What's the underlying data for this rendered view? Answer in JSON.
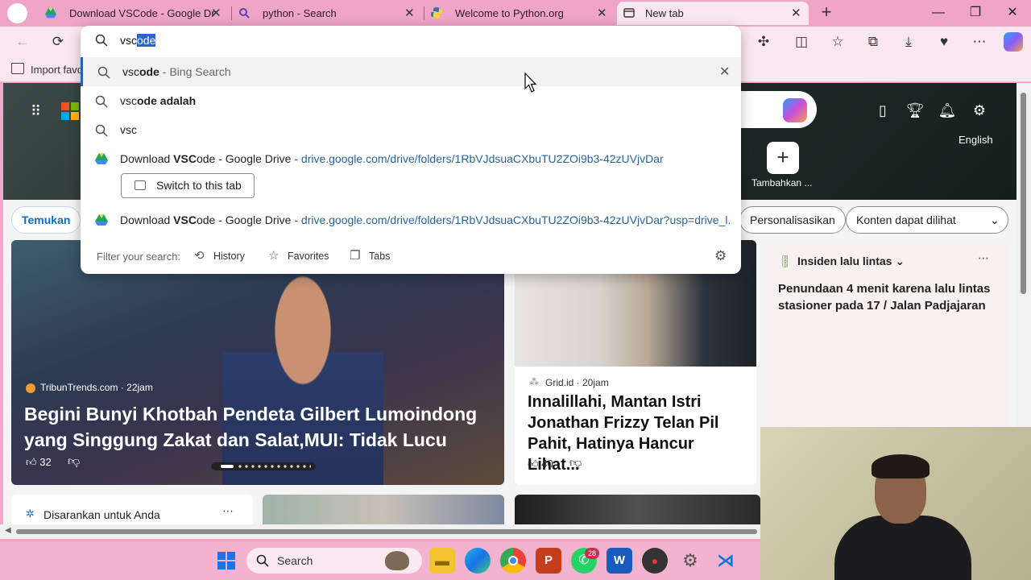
{
  "browser": {
    "tabs": [
      {
        "label": "Download VSCode - Google Driv",
        "favicon": "google-drive-icon",
        "active": false
      },
      {
        "label": "python - Search",
        "favicon": "search-icon",
        "active": false
      },
      {
        "label": "Welcome to Python.org",
        "favicon": "python-icon",
        "active": false
      },
      {
        "label": "New tab",
        "favicon": "new-tab-icon",
        "active": true
      }
    ],
    "favorites_bar_label": "Import favo"
  },
  "omnibox": {
    "typed_plain": "vsc",
    "typed_selected": "ode",
    "suggestions": [
      {
        "icon": "search-icon",
        "prefix": "vsc",
        "bold": "ode",
        "suffix": " - Bing Search",
        "highlighted": true
      },
      {
        "icon": "search-icon",
        "prefix": "vsc",
        "bold": "ode adalah",
        "suffix": ""
      },
      {
        "icon": "search-icon",
        "prefix": "vsc",
        "bold": "",
        "suffix": ""
      }
    ],
    "drive_results": [
      {
        "title_pre": "Download ",
        "title_bold": "VSC",
        "title_post": "ode - Google Drive",
        "url": " - drive.google.com/drive/folders/1RbVJdsuaCXbuTU2ZOi9b3-42zUVjvDar"
      },
      {
        "title_pre": "Download ",
        "title_bold": "VSC",
        "title_post": "ode - Google Drive",
        "url": " - drive.google.com/drive/folders/1RbVJdsuaCXbuTU2ZOi9b3-42zUVjvDar?usp=drive_l..."
      }
    ],
    "switch_tab_label": "Switch to this tab",
    "filter_label": "Filter your search:",
    "filters": [
      "History",
      "Favorites",
      "Tabs"
    ]
  },
  "newtab": {
    "language": "English",
    "add_site_label": "Tambahkan ...",
    "chips": {
      "discover": "Temukan",
      "personalize": "Personalisasikan",
      "visible": "Konten dapat dilihat"
    },
    "lead_story": {
      "source": "TribunTrends.com · 22jam",
      "headline": "Begini Bunyi Khotbah Pendeta Gilbert Lumoindong yang Singgung Zakat dan Salat,MUI: Tidak Lucu",
      "likes": "32"
    },
    "second_story": {
      "source": "Grid.id · 20jam",
      "headline": "Innalillahi, Mantan Istri Jonathan Frizzy Telan Pil Pahit, Hatinya Hancur Lihat...",
      "likes": "40"
    },
    "traffic": {
      "title": "Insiden lalu lintas",
      "text": "Penundaan 4 menit karena lalu lintas stasioner pada 17 / Jalan Padjajaran"
    },
    "recommended_label": "Disarankan untuk Anda"
  },
  "taskbar": {
    "search_label": "Search",
    "whatsapp_badge": "28"
  },
  "colors": {
    "tabstrip": "#f0a4c6",
    "toolbar": "#fbe7f0",
    "accent": "#2a64c5",
    "link": "#2a6496"
  }
}
